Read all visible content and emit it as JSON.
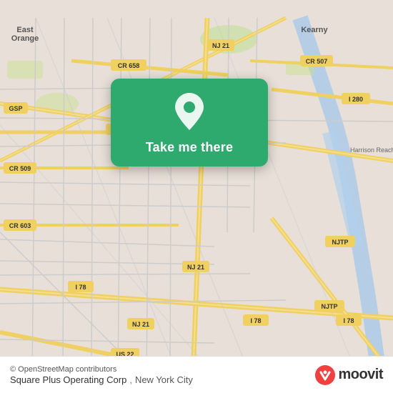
{
  "map": {
    "background_color": "#e8e0d8",
    "attribution": "© OpenStreetMap contributors"
  },
  "card": {
    "button_label": "Take me there",
    "background_color": "#2eaa6e"
  },
  "bottom_bar": {
    "location_name": "Square Plus Operating Corp",
    "location_city": "New York City",
    "moovit_label": "moovit"
  }
}
